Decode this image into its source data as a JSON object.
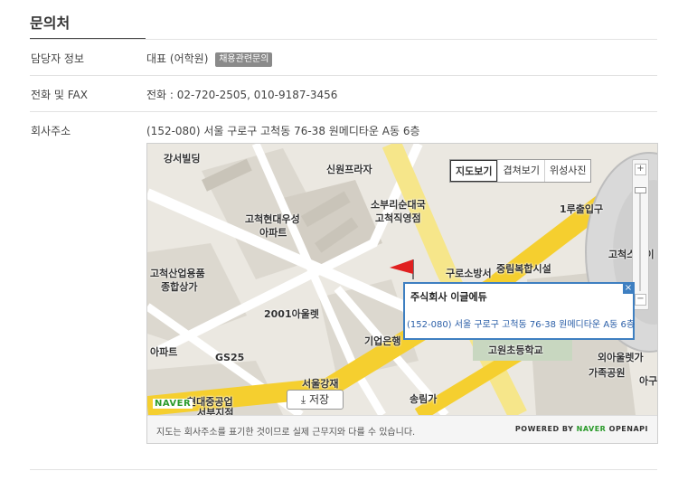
{
  "section_title": "문의처",
  "rows": {
    "contact_label": "담당자 정보",
    "contact_value": "대표 (어학원)",
    "contact_badge": "채용관련문의",
    "phone_label": "전화 및 FAX",
    "phone_value": "전화 : 02-720-2505, 010-9187-3456",
    "address_label": "회사주소",
    "address_value": "(152-080) 서울 구로구 고척동 76-38 원메디타운 A동 6층"
  },
  "map": {
    "type_buttons": [
      "지도보기",
      "겹쳐보기",
      "위성사진"
    ],
    "zoom_in": "+",
    "zoom_out": "−",
    "labels": [
      "강서빌딩",
      "신원프라자",
      "소부리순대국",
      "고척직영점",
      "고척현대우성",
      "아파트",
      "고척산업용품",
      "종합상가",
      "2001아울렛",
      "기업은행",
      "GS25",
      "서울강재",
      "현대중공업",
      "서부지점",
      "구로소방서",
      "중림복합시설",
      "고원초등학교",
      "송림가",
      "외아울렛가",
      "가족공원",
      "고척스카이",
      "1루출입구",
      "아파트",
      "아구"
    ],
    "info_title": "주식회사 이글에듀",
    "info_address": "(152-080) 서울 구로구 고척동 76-38 원메디타운 A동 6층",
    "info_close": "×",
    "save_label": "저장",
    "naver_logo": "NAVER",
    "footer_note": "지도는 회사주소를 표기한 것이므로 실제 근무지와 다를 수 있습니다.",
    "powered_by": "POWERED BY",
    "powered_naver": "NAVER",
    "powered_api": "OPENAPI"
  }
}
